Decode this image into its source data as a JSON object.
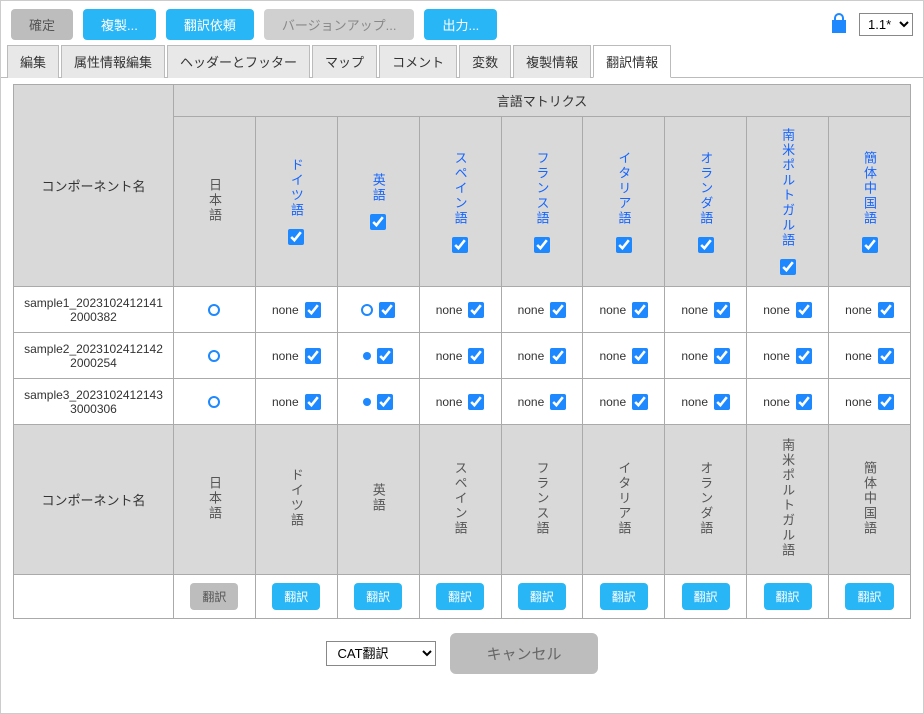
{
  "topbar": {
    "confirm": "確定",
    "duplicate": "複製...",
    "translate_request": "翻訳依頼",
    "version_up": "バージョンアップ...",
    "export": "出力...",
    "version_selected": "1.1*"
  },
  "tabs": [
    {
      "label": "編集",
      "active": false
    },
    {
      "label": "属性情報編集",
      "active": false
    },
    {
      "label": "ヘッダーとフッター",
      "active": false
    },
    {
      "label": "マップ",
      "active": false
    },
    {
      "label": "コメント",
      "active": false
    },
    {
      "label": "変数",
      "active": false
    },
    {
      "label": "複製情報",
      "active": false
    },
    {
      "label": "翻訳情報",
      "active": true
    }
  ],
  "matrix": {
    "title": "言語マトリクス",
    "component_col_label": "コンポーネント名"
  },
  "languages": [
    {
      "name": "日本語",
      "base": true,
      "head_checked": null
    },
    {
      "name": "ドイツ語",
      "base": false,
      "head_checked": true
    },
    {
      "name": "英語",
      "base": false,
      "head_checked": true
    },
    {
      "name": "スペイン語",
      "base": false,
      "head_checked": true
    },
    {
      "name": "フランス語",
      "base": false,
      "head_checked": true
    },
    {
      "name": "イタリア語",
      "base": false,
      "head_checked": true
    },
    {
      "name": "オランダ語",
      "base": false,
      "head_checked": true
    },
    {
      "name": "南米ポルトガル語",
      "base": false,
      "head_checked": true
    },
    {
      "name": "簡体中国語",
      "base": false,
      "head_checked": true
    }
  ],
  "rows": [
    {
      "name": "sample1_20231024121412000382",
      "cells": [
        {
          "status": "circle-open",
          "checked": null
        },
        {
          "status": "none",
          "checked": true
        },
        {
          "status": "circle-open",
          "checked": true
        },
        {
          "status": "none",
          "checked": true
        },
        {
          "status": "none",
          "checked": true
        },
        {
          "status": "none",
          "checked": true
        },
        {
          "status": "none",
          "checked": true
        },
        {
          "status": "none",
          "checked": true
        },
        {
          "status": "none",
          "checked": true
        }
      ]
    },
    {
      "name": "sample2_20231024121422000254",
      "cells": [
        {
          "status": "circle-open",
          "checked": null
        },
        {
          "status": "none",
          "checked": true
        },
        {
          "status": "dot",
          "checked": true
        },
        {
          "status": "none",
          "checked": true
        },
        {
          "status": "none",
          "checked": true
        },
        {
          "status": "none",
          "checked": true
        },
        {
          "status": "none",
          "checked": true
        },
        {
          "status": "none",
          "checked": true
        },
        {
          "status": "none",
          "checked": true
        }
      ]
    },
    {
      "name": "sample3_20231024121433000306",
      "cells": [
        {
          "status": "circle-open",
          "checked": null
        },
        {
          "status": "none",
          "checked": true
        },
        {
          "status": "dot",
          "checked": true
        },
        {
          "status": "none",
          "checked": true
        },
        {
          "status": "none",
          "checked": true
        },
        {
          "status": "none",
          "checked": true
        },
        {
          "status": "none",
          "checked": true
        },
        {
          "status": "none",
          "checked": true
        },
        {
          "status": "none",
          "checked": true
        }
      ]
    }
  ],
  "translate_button_label": "翻訳",
  "bottom": {
    "method_selected": "CAT翻訳",
    "cancel": "キャンセル"
  },
  "status_text": {
    "none": "none"
  }
}
